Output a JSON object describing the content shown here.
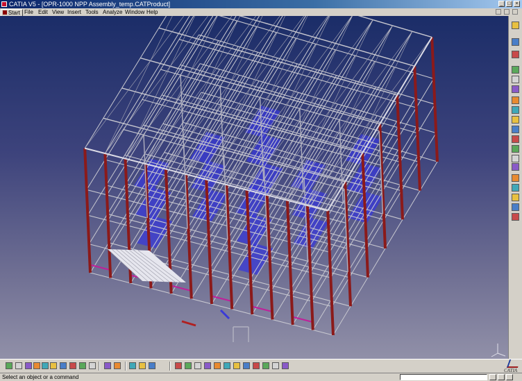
{
  "window": {
    "title": "CATIA V5 - [OPR-1000 NPP Assembly_temp.CATProduct]",
    "controls": [
      "minimize",
      "maximize",
      "close"
    ]
  },
  "menu": {
    "start_label": "Start",
    "items": [
      "File",
      "Edit",
      "View",
      "Insert",
      "Tools",
      "Analyze",
      "Window",
      "Help"
    ]
  },
  "viewport": {
    "content": "3D steel-frame building structure assembly",
    "colors": {
      "columns": "#8b1a1a",
      "beams": "#c8c8d0",
      "floor_members": "#3a3ad8",
      "secondary": "#c0209a",
      "background_top": "#1b2d68",
      "background_bottom": "#9190a8"
    },
    "compass_icon": "axis-compass-icon"
  },
  "right_toolbar": {
    "icons": [
      "product-icon",
      "select-arrow-icon",
      "rotate-icon",
      "insert-component-icon",
      "insert-product-icon",
      "insert-part-icon",
      "replace-component-icon",
      "graph-tree-icon",
      "multi-instantiation-icon",
      "fast-multi-instantiation-icon",
      "reorder-icon",
      "generate-numbering-icon",
      "manipulation-icon",
      "snap-icon",
      "explode-icon",
      "constraint-icon",
      "update-icon",
      "bulb-icon",
      "fix-icon"
    ]
  },
  "bottom_toolbar": {
    "icons": [
      "new-icon",
      "open-icon",
      "save-icon",
      "print-icon",
      "cut-icon",
      "copy-icon",
      "paste-icon",
      "undo-icon",
      "redo-icon",
      "whats-this-icon",
      "formula-icon",
      "comment-icon",
      "catalog-icon",
      "measure-icon",
      "parts-icon",
      "fly-mode-icon",
      "fit-all-icon",
      "pan-icon",
      "rotate-view-icon",
      "zoom-in-icon",
      "zoom-out-icon",
      "normal-view-icon",
      "isometric-view-icon",
      "shading-icon",
      "hide-show-icon",
      "swap-visible-icon",
      "render-icon"
    ],
    "logo_text": "CATIA"
  },
  "status": {
    "message": "Select an object or a command",
    "command_value": ""
  }
}
